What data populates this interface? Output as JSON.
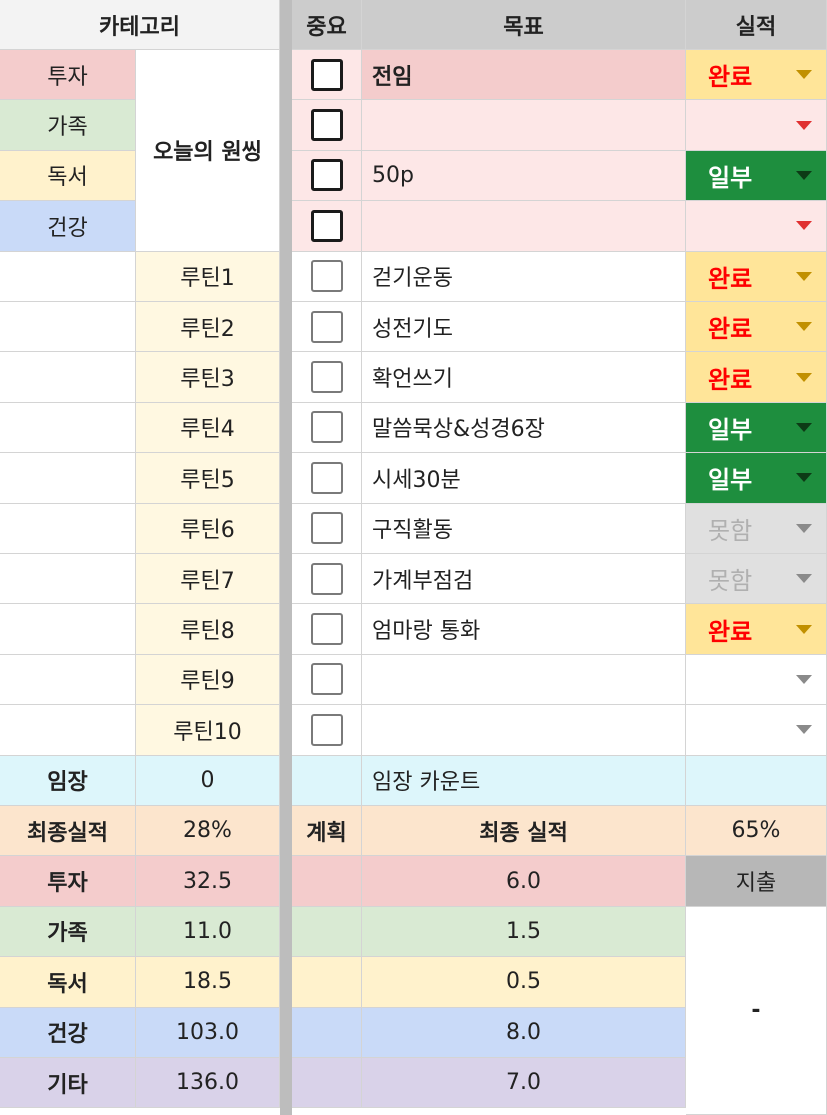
{
  "header": {
    "category": "카테고리",
    "important": "중요",
    "goal": "목표",
    "result": "실적"
  },
  "categories": [
    {
      "label": "투자",
      "color": "#f4cccc"
    },
    {
      "label": "가족",
      "color": "#d9ead3"
    },
    {
      "label": "독서",
      "color": "#fff2cc"
    },
    {
      "label": "건강",
      "color": "#c9daf8"
    }
  ],
  "oneThing": "오늘의 원씽",
  "topGoals": [
    {
      "text": "전임",
      "status": "완료"
    },
    {
      "text": "",
      "status": ""
    },
    {
      "text": "50p",
      "status": "일부"
    },
    {
      "text": "",
      "status": ""
    }
  ],
  "routines": [
    {
      "label": "루틴1",
      "goal": "걷기운동",
      "status": "완료"
    },
    {
      "label": "루틴2",
      "goal": "성전기도",
      "status": "완료"
    },
    {
      "label": "루틴3",
      "goal": "확언쓰기",
      "status": "완료"
    },
    {
      "label": "루틴4",
      "goal": "말씀묵상&성경6장",
      "status": "일부"
    },
    {
      "label": "루틴5",
      "goal": "시세30분",
      "status": "일부"
    },
    {
      "label": "루틴6",
      "goal": "구직활동",
      "status": "못함"
    },
    {
      "label": "루틴7",
      "goal": "가계부점검",
      "status": "못함"
    },
    {
      "label": "루틴8",
      "goal": "엄마랑 통화",
      "status": "완료"
    },
    {
      "label": "루틴9",
      "goal": "",
      "status": ""
    },
    {
      "label": "루틴10",
      "goal": "",
      "status": ""
    }
  ],
  "imjang": {
    "label": "임장",
    "value": "0",
    "counter": "임장 카운트"
  },
  "final": {
    "label": "최종실적",
    "value": "28%",
    "plan": "계획",
    "title": "최종 실적",
    "percent": "65%"
  },
  "summary": [
    {
      "label": "투자",
      "value": "32.5",
      "final": "6.0",
      "color": "#f4cccc"
    },
    {
      "label": "가족",
      "value": "11.0",
      "final": "1.5",
      "color": "#d9ead3"
    },
    {
      "label": "독서",
      "value": "18.5",
      "final": "0.5",
      "color": "#fff2cc"
    },
    {
      "label": "건강",
      "value": "103.0",
      "final": "8.0",
      "color": "#c9daf8"
    },
    {
      "label": "기타",
      "value": "136.0",
      "final": "7.0",
      "color": "#d9d2e9"
    }
  ],
  "expense": {
    "label": "지출",
    "value": "-"
  },
  "statusStyles": {
    "완료": {
      "bg": "#ffe599",
      "fg": "#ff0000",
      "arrow": "#c19000"
    },
    "일부": {
      "bg": "#1e8e3e",
      "fg": "#ffffff",
      "arrow": "#0d3b16"
    },
    "못함": {
      "bg": "#e0e0e0",
      "fg": "#b0b0b0",
      "arrow": "#8a8a8a"
    }
  }
}
